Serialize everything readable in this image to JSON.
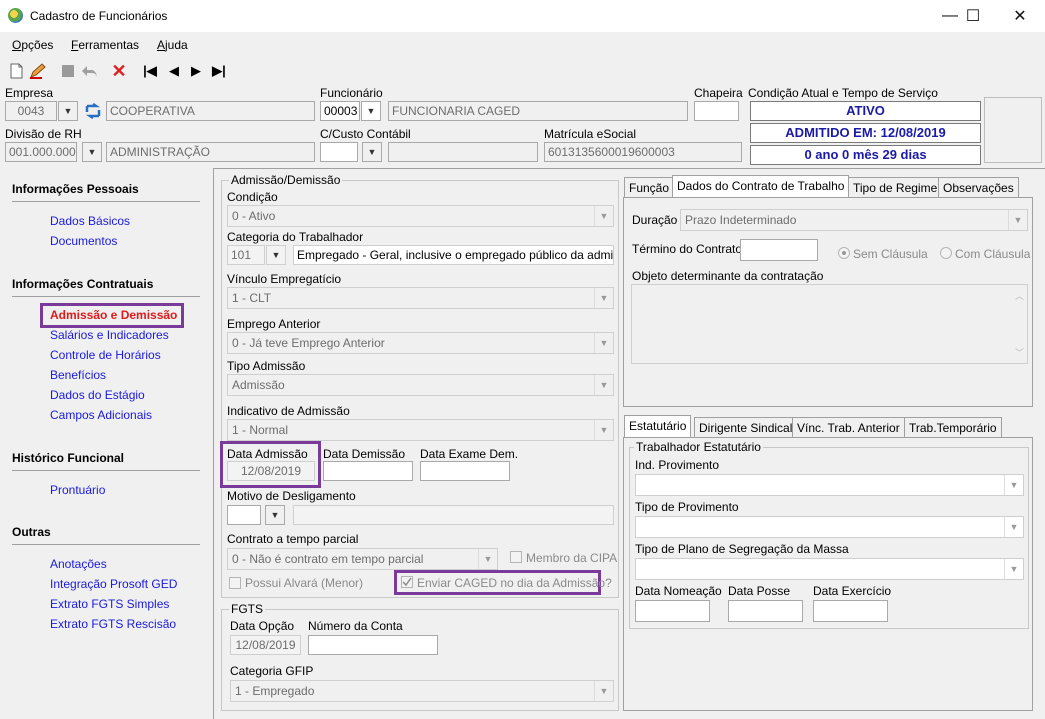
{
  "window": {
    "title": "Cadastro de Funcionários",
    "minimize": "—",
    "maximize": "☐",
    "close": "✕"
  },
  "menu": [
    {
      "pre": "",
      "u": "O",
      "post": "pções"
    },
    {
      "pre": "",
      "u": "F",
      "post": "erramentas"
    },
    {
      "pre": "",
      "u": "A",
      "post": "juda"
    }
  ],
  "toolbar": {
    "first": "|◀",
    "prev": "◀",
    "next": "▶",
    "last": "▶|",
    "delete": "✕"
  },
  "header": {
    "empresa_label": "Empresa",
    "empresa_code": "0043",
    "empresa_name": "COOPERATIVA",
    "funcionario_label": "Funcionário",
    "funcionario_code": "00003",
    "funcionario_name": "FUNCIONARIA CAGED",
    "chapeira_label": "Chapeira",
    "chapeira_value": "",
    "divisao_label": "Divisão de RH",
    "divisao_code": "001.000.000",
    "divisao_name": "ADMINISTRAÇÃO",
    "custo_label": "C/Custo Contábil",
    "custo_value": "",
    "matricula_label": "Matrícula eSocial",
    "matricula_value": "6013135600019600003",
    "condicao_label": "Condição Atual e Tempo de Serviço",
    "status": "ATIVO",
    "admitido": "ADMITIDO EM: 12/08/2019",
    "tempo": "0 ano 0 mês 29 dias"
  },
  "sidebar": {
    "sections": [
      {
        "title": "Informações Pessoais",
        "items": [
          "Dados Básicos",
          "Documentos"
        ]
      },
      {
        "title": "Informações Contratuais",
        "items": [
          "Admissão e Demissão",
          "Salários e Indicadores",
          "Controle de Horários",
          "Benefícios",
          "Dados do Estágio",
          "Campos Adicionais"
        ]
      },
      {
        "title": "Histórico Funcional",
        "items": [
          "Prontuário"
        ]
      },
      {
        "title": "Outras",
        "items": [
          "Anotações",
          "Integração Prosoft GED",
          "Extrato FGTS Simples",
          "Extrato FGTS Rescisão"
        ]
      }
    ]
  },
  "admissao": {
    "group_title": "Admissão/Demissão",
    "condicao_label": "Condição",
    "condicao_value": "0 - Ativo",
    "categoria_label": "Categoria do Trabalhador",
    "categoria_code": "101",
    "categoria_desc": "Empregado - Geral, inclusive o empregado público da administ",
    "vinculo_label": "Vínculo Empregatício",
    "vinculo_value": "1 - CLT",
    "emprego_label": "Emprego Anterior",
    "emprego_value": "0 - Já teve Emprego Anterior",
    "tipo_label": "Tipo Admissão",
    "tipo_value": "Admissão",
    "indicativo_label": "Indicativo de Admissão",
    "indicativo_value": "1 - Normal",
    "data_adm_label": "Data Admissão",
    "data_adm_value": "12/08/2019",
    "data_dem_label": "Data Demissão",
    "data_dem_value": "",
    "data_exame_label": "Data Exame Dem.",
    "data_exame_value": "",
    "motivo_label": "Motivo de Desligamento",
    "contrato_label": "Contrato a tempo parcial",
    "contrato_value": "0 - Não é contrato em tempo parcial",
    "cipa_label": "Membro da CIPA",
    "alvara_label": "Possui Alvará (Menor)",
    "caged_label": "Enviar CAGED no dia da Admissão?"
  },
  "fgts": {
    "group_title": "FGTS",
    "data_opcao_label": "Data Opção",
    "data_opcao_value": "12/08/2019",
    "conta_label": "Número da Conta",
    "conta_value": "",
    "categoria_label": "Categoria GFIP",
    "categoria_value": "1 - Empregado"
  },
  "contract_tabs": [
    "Função",
    "Dados do Contrato de Trabalho",
    "Tipo de Regime",
    "Observações"
  ],
  "contract": {
    "duracao_label": "Duração",
    "duracao_value": "Prazo Indeterminado",
    "termino_label": "Término do Contrato",
    "termino_value": "",
    "sem_clausula": "Sem Cláusula",
    "com_clausula": "Com Cláusula",
    "objeto_label": "Objeto determinante da contratação"
  },
  "regime_tabs": [
    "Estatutário",
    "Dirigente Sindical",
    "Vínc. Trab. Anterior",
    "Trab.Temporário"
  ],
  "estatutario": {
    "group_title": "Trabalhador Estatutário",
    "ind_label": "Ind. Provimento",
    "tipo_label": "Tipo de Provimento",
    "plano_label": "Tipo de Plano de Segregação da Massa",
    "nomeacao_label": "Data Nomeação",
    "posse_label": "Data Posse",
    "exercicio_label": "Data Exercício"
  },
  "colors": {
    "link": "#1a1ae0",
    "active_link": "#e01a1a",
    "highlight": "#7a3a99",
    "status_text": "#1a1aa6"
  }
}
